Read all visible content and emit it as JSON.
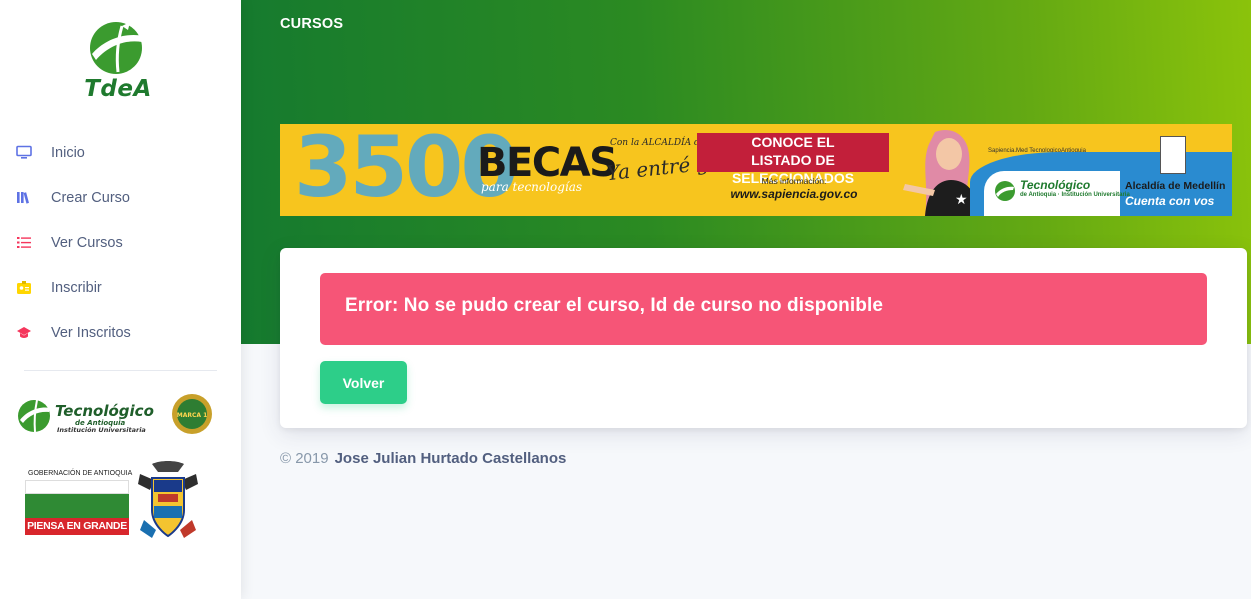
{
  "app": {
    "brand": "TdeA",
    "accent_color": "#2dce89",
    "danger_color": "#f65577"
  },
  "header": {
    "title": "CURSOS"
  },
  "sidebar": {
    "items": [
      {
        "label": "Inicio",
        "icon": "monitor-icon",
        "color": "#5e72e4"
      },
      {
        "label": "Crear Curso",
        "icon": "books-icon",
        "color": "#5e72e4"
      },
      {
        "label": "Ver Cursos",
        "icon": "list-icon",
        "color": "#f5365c"
      },
      {
        "label": "Inscribir",
        "icon": "badge-icon",
        "color": "#ffd600"
      },
      {
        "label": "Ver Inscritos",
        "icon": "graduation-cap-icon",
        "color": "#f5365c"
      }
    ],
    "logos": {
      "tda_title": "Tecnológico",
      "tda_sub1": "de Antioquia",
      "tda_sub2": "Institución Universitaria",
      "tda_seal": "MARCA 1",
      "gob_small": "GOBERNACIÓN DE ANTIOQUIA",
      "gob_slogan": "PIENSA EN GRANDE"
    }
  },
  "banner": {
    "big_number": "3500",
    "becas": "BECAS",
    "para": "para tecnologías",
    "alcaldia_small": "Con la ALCALDÍA de MEDELLÍN",
    "ya_entre": "Ya entré ganando",
    "cta_line1": "CONOCE EL",
    "cta_line2": "LISTADO DE SELECCIONADOS",
    "info": "Más información:",
    "website": "www.sapiencia.gov.co",
    "social": "Sapiencia.Med  TecnologicoAntioquia",
    "tec_name": "Tecnológico",
    "tec_sub": "de Antioquia · Institución Universitaria",
    "alcaldia": "Alcaldía de Medellín",
    "cuenta": "Cuenta con vos"
  },
  "card": {
    "error_message": "Error: No se pudo crear el curso, Id de curso no disponible",
    "back_button": "Volver"
  },
  "footer": {
    "copyright": "© 2019",
    "author": "Jose Julian Hurtado Castellanos"
  }
}
